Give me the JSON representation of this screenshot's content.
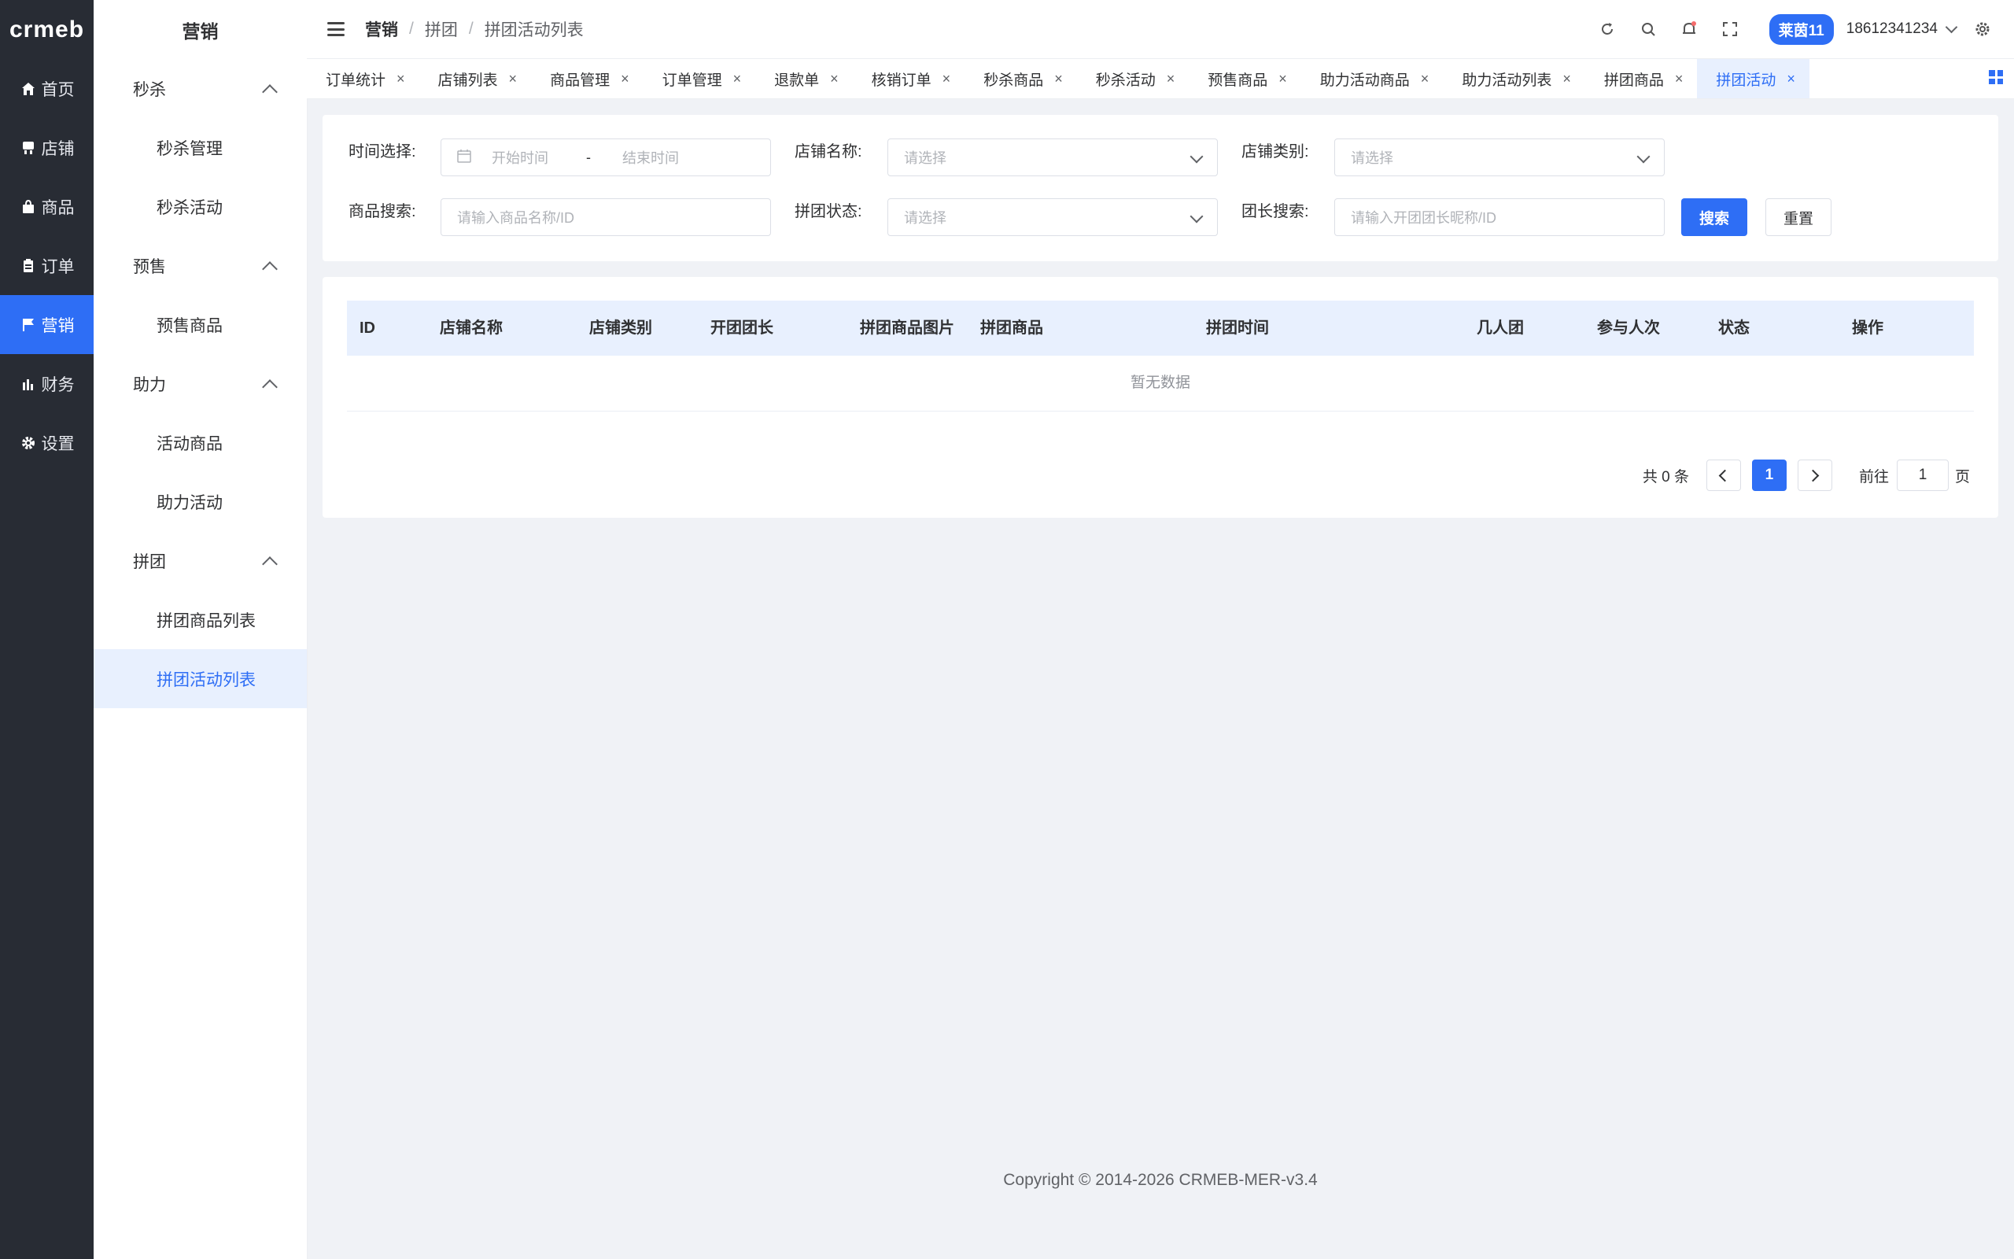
{
  "rail": {
    "logo": "crmeb",
    "items": [
      {
        "label": "首页",
        "icon": "home-icon"
      },
      {
        "label": "店铺",
        "icon": "store-icon"
      },
      {
        "label": "商品",
        "icon": "bag-icon"
      },
      {
        "label": "订单",
        "icon": "clipboard-icon"
      },
      {
        "label": "营销",
        "icon": "flag-icon"
      },
      {
        "label": "财务",
        "icon": "bar-chart-icon"
      },
      {
        "label": "设置",
        "icon": "gear-icon"
      }
    ]
  },
  "submenu": {
    "title": "营销",
    "groups": [
      {
        "label": "秒杀",
        "items": [
          "秒杀管理",
          "秒杀活动"
        ]
      },
      {
        "label": "预售",
        "items": [
          "预售商品"
        ]
      },
      {
        "label": "助力",
        "items": [
          "活动商品",
          "助力活动"
        ]
      },
      {
        "label": "拼团",
        "items": [
          "拼团商品列表",
          "拼团活动列表"
        ]
      }
    ]
  },
  "header": {
    "breadcrumb": [
      "营销",
      "拼团",
      "拼团活动列表"
    ],
    "separator": "/",
    "store_name": "莱茵11",
    "user_phone": "18612341234"
  },
  "tabs": [
    "订单统计",
    "店铺列表",
    "商品管理",
    "订单管理",
    "退款单",
    "核销订单",
    "秒杀商品",
    "秒杀活动",
    "预售商品",
    "助力活动商品",
    "助力活动列表",
    "拼团商品",
    "拼团活动"
  ],
  "tab_close": "×",
  "filters": {
    "time_label": "时间选择:",
    "time_start_placeholder": "开始时间",
    "time_separator": "-",
    "time_end_placeholder": "结束时间",
    "store_name_label": "店铺名称:",
    "store_name_placeholder": "请选择",
    "store_type_label": "店铺类别:",
    "store_type_placeholder": "请选择",
    "product_search_label": "商品搜索:",
    "product_search_placeholder": "请输入商品名称/ID",
    "group_status_label": "拼团状态:",
    "group_status_placeholder": "请选择",
    "leader_search_label": "团长搜索:",
    "leader_search_placeholder": "请输入开团团长昵称/ID",
    "search_button": "搜索",
    "reset_button": "重置"
  },
  "table": {
    "columns": [
      "ID",
      "店铺名称",
      "店铺类别",
      "开团团长",
      "拼团商品图片",
      "拼团商品",
      "拼团时间",
      "几人团",
      "参与人次",
      "状态",
      "操作"
    ],
    "empty_text": "暂无数据"
  },
  "pagination": {
    "total_text": "共 0 条",
    "current_page": "1",
    "goto_label": "前往",
    "goto_value": "1",
    "page_suffix": "页"
  },
  "footer": {
    "copyright": "Copyright © 2014-2026 CRMEB-MER-v3.4"
  },
  "colors": {
    "primary": "#2e6ef5",
    "rail_bg": "#282c34",
    "active_bg": "#e8f0fe"
  }
}
